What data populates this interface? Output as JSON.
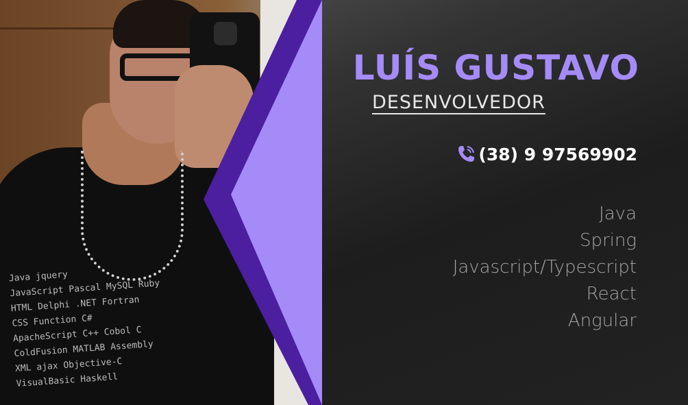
{
  "card": {
    "name": "LUÍS GUSTAVO",
    "role": "DESENVOLVEDOR",
    "phone": "(38) 9 97569902",
    "skills": [
      "Java",
      "Spring",
      "Javascript/Typescript",
      "React",
      "Angular"
    ]
  },
  "photo": {
    "shirt_words": [
      "Java  jquery",
      "JavaScript  Pascal MySQL Ruby",
      "HTML Delphi  .NET  Fortran",
      "CSS  Function  C#",
      "ApacheScript C++  Cobol  C",
      "ColdFusion MATLAB  Assembly",
      "XML  ajax  Objective-C",
      "VisualBasic  Haskell"
    ]
  },
  "colors": {
    "accent_light": "#a58bf7",
    "accent_dark": "#4b1fa0",
    "background": "#2a2a2a",
    "skill_text": "#a4a4a4"
  },
  "icons": {
    "phone": "phone-call-icon"
  }
}
